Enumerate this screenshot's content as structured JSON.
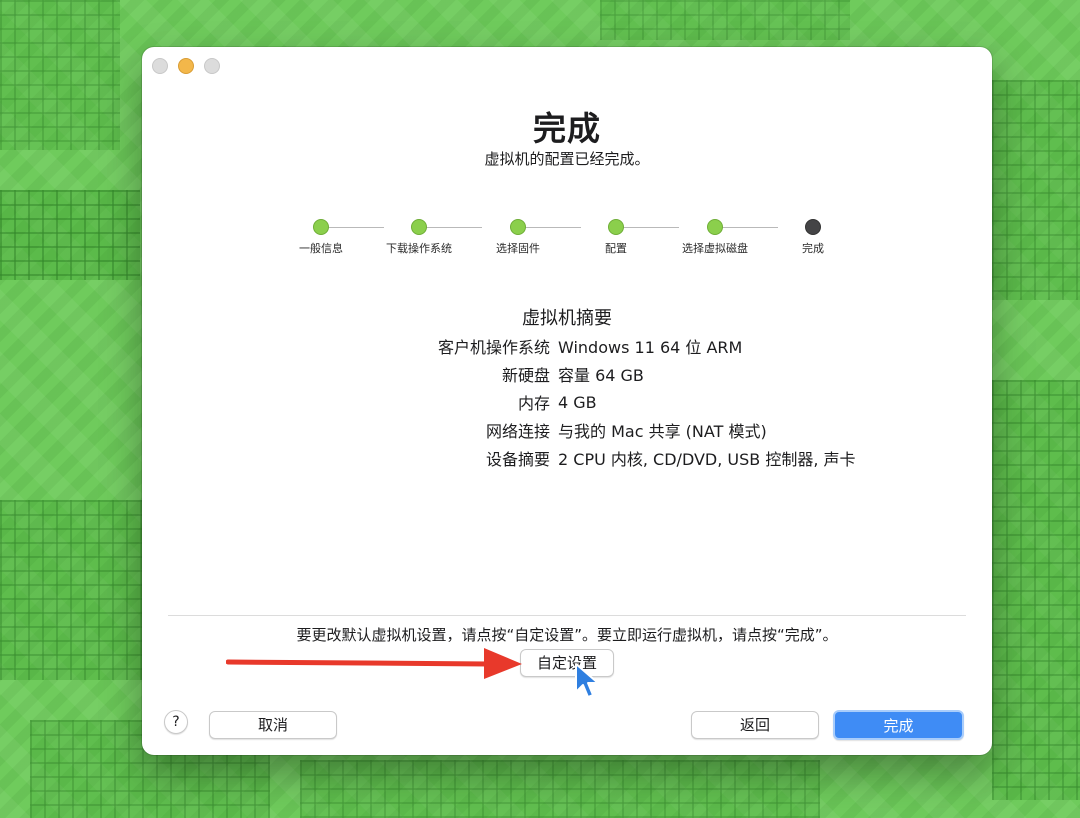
{
  "window": {
    "title": "完成",
    "subtitle": "虚拟机的配置已经完成。"
  },
  "steps": [
    {
      "label": "一般信息",
      "state": "done"
    },
    {
      "label": "下载操作系统",
      "state": "done"
    },
    {
      "label": "选择固件",
      "state": "done"
    },
    {
      "label": "配置",
      "state": "done"
    },
    {
      "label": "选择虚拟磁盘",
      "state": "done"
    },
    {
      "label": "完成",
      "state": "current"
    }
  ],
  "summary": {
    "title": "虚拟机摘要",
    "rows": [
      {
        "key": "客户机操作系统",
        "value": "Windows 11 64 位 ARM"
      },
      {
        "key": "新硬盘",
        "value": "容量 64 GB"
      },
      {
        "key": "内存",
        "value": "4 GB"
      },
      {
        "key": "网络连接",
        "value": "与我的 Mac 共享 (NAT 模式)"
      },
      {
        "key": "设备摘要",
        "value": "2 CPU 内核, CD/DVD, USB 控制器, 声卡"
      }
    ]
  },
  "footer": {
    "hint": "要更改默认虚拟机设置，请点按“自定设置”。要立即运行虚拟机，请点按“完成”。",
    "customize_label": "自定设置",
    "help_label": "?",
    "cancel_label": "取消",
    "back_label": "返回",
    "done_label": "完成"
  },
  "colors": {
    "background": "#6fcb5c",
    "step_done": "#8bcf4c",
    "step_current": "#444446",
    "primary_button": "#3f8cf5",
    "annotation_arrow": "#e8392b"
  },
  "icons": {
    "help": "question-mark-icon",
    "arrow": "red-arrow-annotation",
    "cursor": "mouse-pointer-icon"
  }
}
